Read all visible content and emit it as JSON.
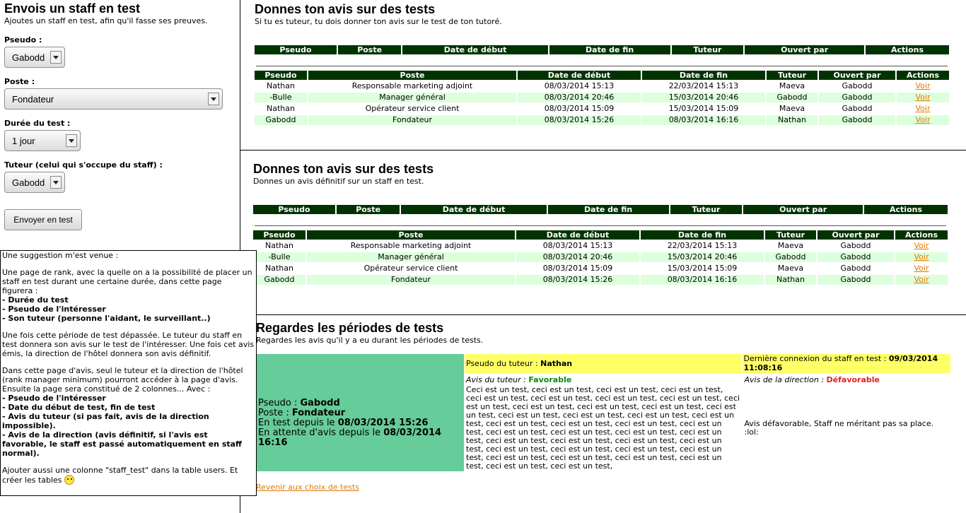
{
  "left_form": {
    "title": "Envois un staff en test",
    "subtitle": "Ajoutes un staff en test, afin qu'il fasse ses preuves.",
    "pseudo_label": "Pseudo :",
    "pseudo_value": "Gabodd",
    "poste_label": "Poste :",
    "poste_value": "Fondateur",
    "duree_label": "Durée du test :",
    "duree_value": "1 jour",
    "tuteur_label": "Tuteur (celui qui s'occupe du staff) :",
    "tuteur_value": "Gabodd",
    "submit_label": "Envoyer en test"
  },
  "note": {
    "intro": "Une suggestion m'est venue :",
    "p1": "Une page de rank, avec la quelle on a la possibilité de placer un staff en test durant une certaine durée, dans cette page figurera :",
    "p1_items": [
      "- Durée du test",
      "- Pseudo de l'intéresser",
      "- Son tuteur (personne l'aidant, le surveillant..)"
    ],
    "p2": "Une fois cette période de test dépassée. Le tuteur du staff en test donnera son avis sur le test de l'intéresser. Une fois cet avis émis, la direction de l'hôtel donnera son avis définitif.",
    "p3": "Dans cette page d'avis, seul le tuteur et la direction de l'hôtel (rank manager minimum) pourront accéder à la page d'avis.",
    "p3b": "Ensuite la page sera constitué de 2 colonnes... Avec :",
    "p3_items": [
      "- Pseudo de l'intéresser",
      "- Date du début de test, fin de test",
      "- Avis du tuteur (si pas fait, avis de la direction impossible).",
      "- Avis de la direction (avis définitif, si l'avis est favorable, le staff est passé automatiquement en staff normal)."
    ],
    "p4": "Ajouter aussi une colonne \"staff_test\" dans la table users. Et créer les tables"
  },
  "headers": [
    "Pseudo",
    "Poste",
    "Date de début",
    "Date de fin",
    "Tuteur",
    "Ouvert par",
    "Actions"
  ],
  "action_label": "Voir",
  "section1": {
    "title": "Donnes ton avis sur des tests",
    "subtitle": "Si tu es tuteur, tu dois donner ton avis sur le test de ton tutoré.",
    "rows": [
      [
        "Nathan",
        "Responsable marketing adjoint",
        "08/03/2014 15:13",
        "22/03/2014 15:13",
        "Maeva",
        "Gabodd"
      ],
      [
        "-Bulle",
        "Manager général",
        "08/03/2014 20:46",
        "15/03/2014 20:46",
        "Gabodd",
        "Gabodd"
      ],
      [
        "Nathan",
        "Opérateur service client",
        "08/03/2014 15:09",
        "15/03/2014 15:09",
        "Maeva",
        "Gabodd"
      ],
      [
        "Gabodd",
        "Fondateur",
        "08/03/2014 15:26",
        "08/03/2014 16:16",
        "Nathan",
        "Gabodd"
      ]
    ]
  },
  "section2": {
    "title": "Donnes ton avis sur des tests",
    "subtitle": "Donnes un avis définitif sur un staff en test.",
    "rows": [
      [
        "Nathan",
        "Responsable marketing adjoint",
        "08/03/2014 15:13",
        "22/03/2014 15:13",
        "Maeva",
        "Gabodd"
      ],
      [
        "-Bulle",
        "Manager général",
        "08/03/2014 20:46",
        "15/03/2014 20:46",
        "Gabodd",
        "Gabodd"
      ],
      [
        "Nathan",
        "Opérateur service client",
        "08/03/2014 15:09",
        "15/03/2014 15:09",
        "Maeva",
        "Gabodd"
      ],
      [
        "Gabodd",
        "Fondateur",
        "08/03/2014 15:26",
        "08/03/2014 16:16",
        "Nathan",
        "Gabodd"
      ]
    ]
  },
  "section3": {
    "title": "Regardes les périodes de tests",
    "subtitle": "Regardes les avis qu'il y a eu durant les périodes de tests.",
    "pseudo_label": "Pseudo : ",
    "pseudo_value": "Gabodd",
    "poste_label": "Poste : ",
    "poste_value": "Fondateur",
    "en_test_label": "En test depuis le ",
    "en_test_value": "08/03/2014 15:26",
    "attente_label": "En attente d'avis depuis le ",
    "attente_value": "08/03/2014 16:16",
    "tuteur_label": "Pseudo du tuteur : ",
    "tuteur_value": "Nathan",
    "connexion_label": "Dernière connexion du staff en test : ",
    "connexion_value": "09/03/2014 11:08:16",
    "avis_tuteur_label": "Avis du tuteur : ",
    "avis_tuteur_value": "Favorable",
    "avis_direction_label": "Avis de la direction : ",
    "avis_direction_value": "Défavorable",
    "avis_tuteur_text": "Ceci est un test, ceci est un test, ceci est un test, ceci est un test, ceci est un test, ceci est un test, ceci est un test, ceci est un test, ceci est un test, ceci est un test, ceci est un test, ceci est un test, ceci est un test, ceci est un test, ceci est un test, ceci est un test, ceci est un test, ceci est un test, ceci est un test, ceci est un test, ceci est un test, ceci est un test, ceci est un test, ceci est un test, ceci est un test, ceci est un test, ceci est un test, ceci est un test, ceci est un test, ceci est un test, ceci est un test, ceci est un test, ceci est un test, ceci est un test, ceci est un test, ceci est un test, ceci est un test, ceci est un test, ceci est un test,",
    "avis_direction_text": "Avis défavorable, Staff ne méritant pas sa place. :lol:",
    "back_link": "Revenir aux choix de tests"
  },
  "colors": {
    "header_bg": "#003300",
    "row_highlight": "#dcffdc",
    "link": "#e07b00",
    "review_main_bg": "#66cc99",
    "review_header_bg": "#ffff66",
    "favorable": "#0a8a0a",
    "defavorable": "#e02020"
  }
}
